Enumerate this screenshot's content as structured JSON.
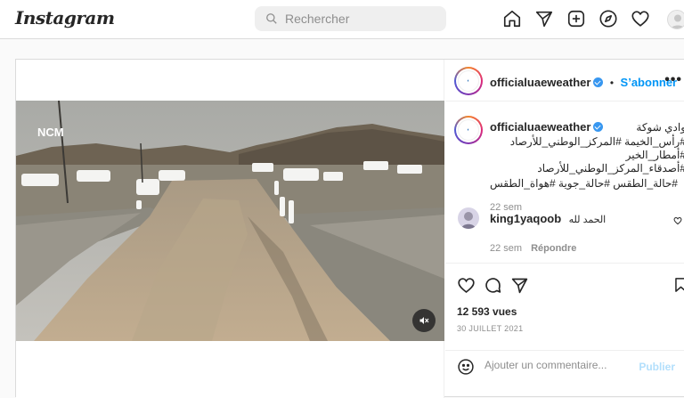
{
  "header": {
    "logo": "Instagram",
    "search_placeholder": "Rechercher",
    "nav_icons": [
      "home-icon",
      "direct-icon",
      "new-post-icon",
      "explore-icon",
      "activity-icon",
      "profile-icon"
    ]
  },
  "post": {
    "author": "officialuaeweather",
    "follow_label": "Sabonner",
    "follow_label_full": "S’abonner",
    "more_label": "•••",
    "video_logo": "NCM",
    "caption_author": "officialuaeweather",
    "caption_lines": [
      "وادي شوكة",
      "#رأس_الخيمة #المركز_الوطني_للأرصاد",
      "#أمطار_الخير #أصدقاء_المركز_الوطني_للأرصاد",
      "#حالة_الطقس #حالة_جوية #هواة_الطقس"
    ],
    "caption_time": "22 sem",
    "comment": {
      "author": "king1yaqoob",
      "text": "الحمد لله",
      "time": "22 sem",
      "reply_label": "Répondre"
    },
    "views": "12 593 vues",
    "date": "30 JUILLET 2021",
    "add_comment_placeholder": "Ajouter un commentaire...",
    "publish_label": "Publier"
  },
  "colors": {
    "accent": "#0095f6",
    "border": "#dbdbdb",
    "muted": "#8e8e8e"
  }
}
